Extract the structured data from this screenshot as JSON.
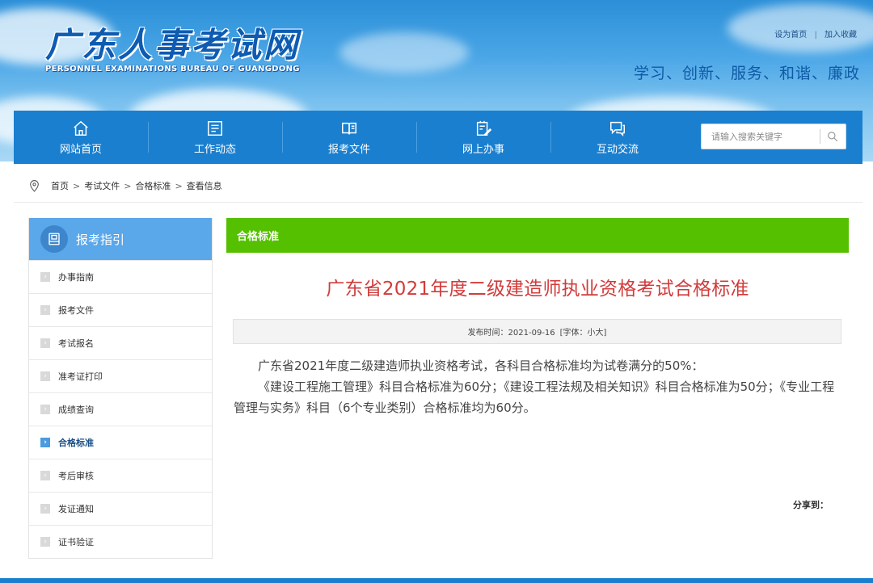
{
  "site": {
    "title": "广东人事考试网",
    "subtitle": "PERSONNEL EXAMINATIONS BUREAU OF GUANGDONG",
    "slogan": "学习、创新、服务、和谐、廉政",
    "top_links": [
      "设为首页",
      "加入收藏"
    ],
    "top_link_sep": "|"
  },
  "nav": {
    "items": [
      {
        "label": "网站首页",
        "icon": "home-icon"
      },
      {
        "label": "工作动态",
        "icon": "news-icon"
      },
      {
        "label": "报考文件",
        "icon": "book-icon"
      },
      {
        "label": "网上办事",
        "icon": "edit-icon"
      },
      {
        "label": "互动交流",
        "icon": "chat-icon"
      }
    ],
    "search_placeholder": "请输入搜索关键字"
  },
  "breadcrumb": {
    "items": [
      "首页",
      "考试文件",
      "合格标准",
      "查看信息"
    ],
    "sep": ">"
  },
  "sidebar": {
    "title": "报考指引",
    "items": [
      {
        "label": "办事指南",
        "active": false
      },
      {
        "label": "报考文件",
        "active": false
      },
      {
        "label": "考试报名",
        "active": false
      },
      {
        "label": "准考证打印",
        "active": false
      },
      {
        "label": "成绩查询",
        "active": false
      },
      {
        "label": "合格标准",
        "active": true
      },
      {
        "label": "考后审核",
        "active": false
      },
      {
        "label": "发证通知",
        "active": false
      },
      {
        "label": "证书验证",
        "active": false
      }
    ]
  },
  "article": {
    "section": "合格标准",
    "title": "广东省2021年度二级建造师执业资格考试合格标准",
    "publish_label": "发布时间：2021-09-16",
    "font_label": "[字体：小大]",
    "paragraphs": [
      "广东省2021年度二级建造师执业资格考试，各科目合格标准均为试卷满分的50%：",
      "《建设工程施工管理》科目合格标准为60分；《建设工程法规及相关知识》科目合格标准为50分；《专业工程管理与实务》科目（6个专业类别）合格标准均为60分。"
    ],
    "share_label": "分享到："
  },
  "colors": {
    "nav_blue": "#1a7fcf",
    "sidebar_head": "#5aa7ea",
    "section_green": "#55c000",
    "title_red": "#d23b3b"
  }
}
